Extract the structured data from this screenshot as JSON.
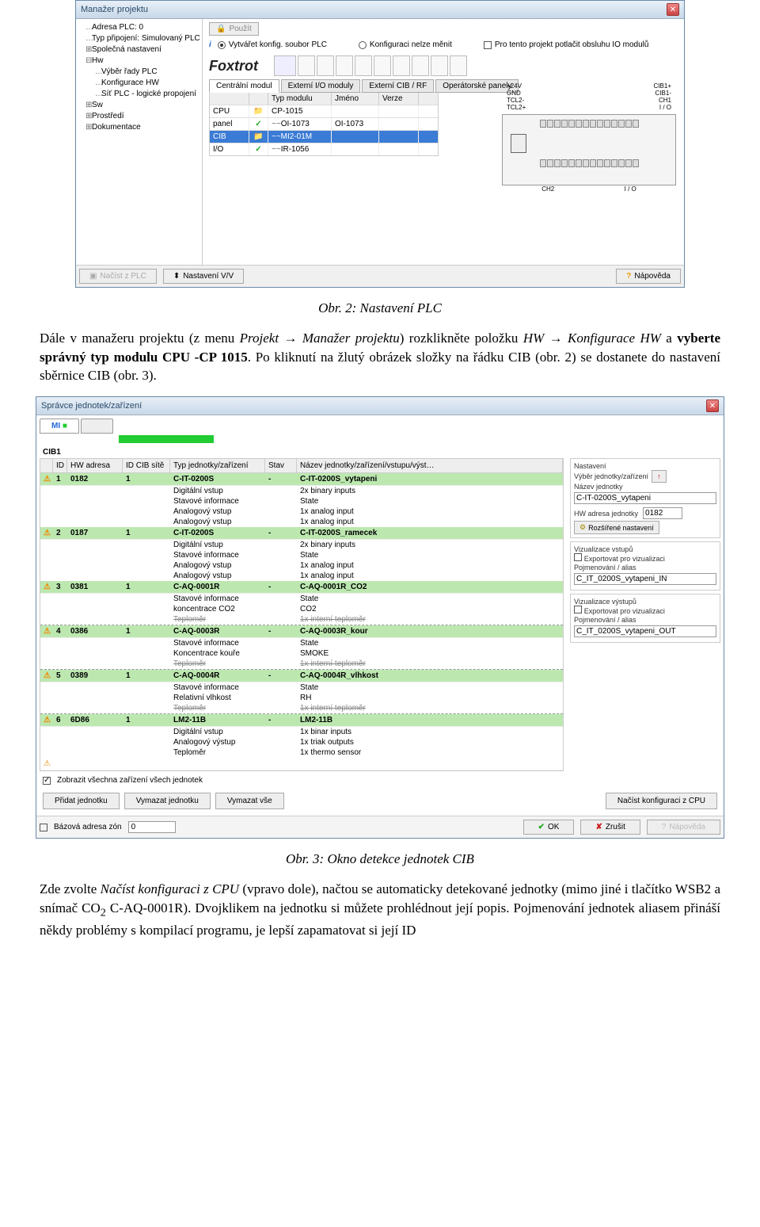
{
  "win1": {
    "title": "Manažer projektu",
    "tree": [
      {
        "lvl": 1,
        "icon": "…",
        "text": "Adresa PLC: 0"
      },
      {
        "lvl": 1,
        "icon": "…",
        "text": "Typ připojení: Simulovaný PLC"
      },
      {
        "lvl": 1,
        "icon": "⊞",
        "text": "Společná nastavení"
      },
      {
        "lvl": 1,
        "icon": "⊟",
        "text": "Hw"
      },
      {
        "lvl": 2,
        "icon": "…",
        "text": "Výběr řady PLC"
      },
      {
        "lvl": 2,
        "icon": "…",
        "text": "Konfigurace HW"
      },
      {
        "lvl": 2,
        "icon": "…",
        "text": "Síť PLC - logické propojení"
      },
      {
        "lvl": 1,
        "icon": "⊞",
        "text": "Sw"
      },
      {
        "lvl": 1,
        "icon": "⊞",
        "text": "Prostředí"
      },
      {
        "lvl": 1,
        "icon": "⊞",
        "text": "Dokumentace"
      }
    ],
    "apply": "Použít",
    "radio1": "Vytvářet konfig. soubor PLC",
    "radio2": "Konfiguraci nelze měnit",
    "suppress": "Pro tento projekt potlačit obsluhu IO modulů",
    "brand": "Foxtrot",
    "tabs": [
      "Centrální modul",
      "Externí I/O moduly",
      "Externí CIB / RF",
      "Operátorské panely"
    ],
    "cols": {
      "typ": "Typ modulu",
      "jmeno": "Jméno",
      "verze": "Verze"
    },
    "rows": [
      {
        "name": "CPU",
        "chk": "folder",
        "type": "CP-1015"
      },
      {
        "name": "panel",
        "chk": "green",
        "type": "~~OI-1073",
        "jmeno": "OI-1073"
      },
      {
        "name": "CIB",
        "chk": "folder",
        "type": "~~MI2-01M",
        "sel": true
      },
      {
        "name": "I/O",
        "chk": "green",
        "type": "~~IR-1056"
      }
    ],
    "plc": {
      "top": [
        "+24V",
        "",
        "CIB1+"
      ],
      "top2": [
        "GND",
        "",
        "CIB1-"
      ],
      "top3": [
        "TCL2-",
        "",
        "CH1"
      ],
      "top4": [
        "TCL2+",
        "",
        "I / O"
      ],
      "bot": [
        "CH2",
        "I / O"
      ]
    },
    "footer": {
      "load": "Načíst z PLC",
      "io": "Nastavení V/V",
      "help": "Nápověda"
    }
  },
  "caption1": "Obr. 2: Nastavení PLC",
  "para1a": "Dále v manažeru projektu (z menu ",
  "para1b": "Projekt → Manažer projektu",
  "para1c": ") rozklikněte položku ",
  "para1d": "HW → Konfigurace HW",
  "para1e": " a ",
  "para1f": "vyberte správný typ modulu CPU -CP 1015",
  "para1g": ". Po kliknutí na žlutý obrázek složky na řádku CIB (obr. 2) se dostanete do nastavení sběrnice CIB (obr. 3).",
  "win2": {
    "title": "Správce jednotek/zařízení",
    "tab_mi": "MI",
    "active_indicator": "■",
    "cib": "CIB1",
    "cols": {
      "id": "ID",
      "adr": "HW adresa",
      "cib": "ID CIB sítě",
      "typ": "Typ jednotky/zařízení",
      "stav": "Stav",
      "naz": "Název jednotky/zařízení/vstupu/výst…"
    },
    "devices": [
      {
        "id": "1",
        "adr": "0182",
        "cib": "1",
        "typ": "C-IT-0200S",
        "stav": "-",
        "naz": "C-IT-0200S_vytapeni",
        "sub": [
          [
            "Digitální vstup",
            "2x binary inputs"
          ],
          [
            "Stavové informace",
            "State"
          ],
          [
            "Analogový vstup",
            "1x analog input"
          ],
          [
            "Analogový vstup",
            "1x analog input"
          ]
        ]
      },
      {
        "id": "2",
        "adr": "0187",
        "cib": "1",
        "typ": "C-IT-0200S",
        "stav": "-",
        "naz": "C-IT-0200S_ramecek",
        "sub": [
          [
            "Digitální vstup",
            "2x binary inputs"
          ],
          [
            "Stavové informace",
            "State"
          ],
          [
            "Analogový vstup",
            "1x analog input"
          ],
          [
            "Analogový vstup",
            "1x analog input"
          ]
        ]
      },
      {
        "id": "3",
        "adr": "0381",
        "cib": "1",
        "typ": "C-AQ-0001R",
        "stav": "-",
        "naz": "C-AQ-0001R_CO2",
        "sub": [
          [
            "Stavové informace",
            "State"
          ],
          [
            "koncentrace CO2",
            "CO2"
          ]
        ],
        "dash": [
          [
            "Teploměr",
            "1x interní teploměr"
          ]
        ]
      },
      {
        "id": "4",
        "adr": "0386",
        "cib": "1",
        "typ": "C-AQ-0003R",
        "stav": "-",
        "naz": "C-AQ-0003R_kour",
        "sub": [
          [
            "Stavové informace",
            "State"
          ],
          [
            "Koncentrace kouře",
            "SMOKE"
          ]
        ],
        "dash": [
          [
            "Teploměr",
            "1x interní teploměr"
          ]
        ]
      },
      {
        "id": "5",
        "adr": "0389",
        "cib": "1",
        "typ": "C-AQ-0004R",
        "stav": "-",
        "naz": "C-AQ-0004R_vlhkost",
        "sub": [
          [
            "Stavové informace",
            "State"
          ],
          [
            "Relativní vlhkost",
            "RH"
          ]
        ],
        "dash": [
          [
            "Teploměr",
            "1x interní teploměr"
          ]
        ]
      },
      {
        "id": "6",
        "adr": "6D86",
        "cib": "1",
        "typ": "LM2-11B",
        "stav": "-",
        "naz": "LM2-11B",
        "sub": [
          [
            "Digitální vstup",
            "1x binar inputs"
          ],
          [
            "Analogový výstup",
            "1x triak outputs"
          ],
          [
            "Teploměr",
            "1x thermo sensor"
          ]
        ]
      }
    ],
    "settings": {
      "title": "Nastavení",
      "sel_label": "Výběr jednotky/zařízení",
      "name_label": "Název jednotky",
      "name_val": "C-IT-0200S_vytapeni",
      "hw_label": "HW adresa jednotky",
      "hw_val": "0182",
      "adv": "Rozšířené nastavení",
      "vis_in": "Vizualizace vstupů",
      "export": "Exportovat pro vizualizaci",
      "alias_label": "Pojmenování / alias",
      "alias_in": "C_IT_0200S_vytapeni_IN",
      "vis_out": "Vizualizace výstupů",
      "alias_out": "C_IT_0200S_vytapeni_OUT"
    },
    "show_all": "Zobrazit všechna zařízení všech jednotek",
    "buttons": {
      "add": "Přidat jednotku",
      "del": "Vymazat jednotku",
      "delall": "Vymazat vše",
      "loadcpu": "Načíst konfiguraci z CPU"
    },
    "footer": {
      "base": "Bázová adresa zón",
      "val": "0",
      "ok": "OK",
      "cancel": "Zrušit",
      "help": "Nápověda"
    }
  },
  "caption2": "Obr. 3: Okno detekce jednotek CIB",
  "para2a": "Zde zvolte ",
  "para2b": "Načíst konfiguraci z CPU",
  "para2c": " (vpravo dole), načtou se automaticky detekované jednotky (mimo jiné i tlačítko WSB2 a snímač CO",
  "para2d": "2",
  "para2e": " C-AQ-0001R). Dvojklikem na jednotku si můžete prohlédnout její popis. Pojmenování jednotek aliasem přináší někdy problémy s kompilací programu, je lepší zapamatovat si její ID"
}
